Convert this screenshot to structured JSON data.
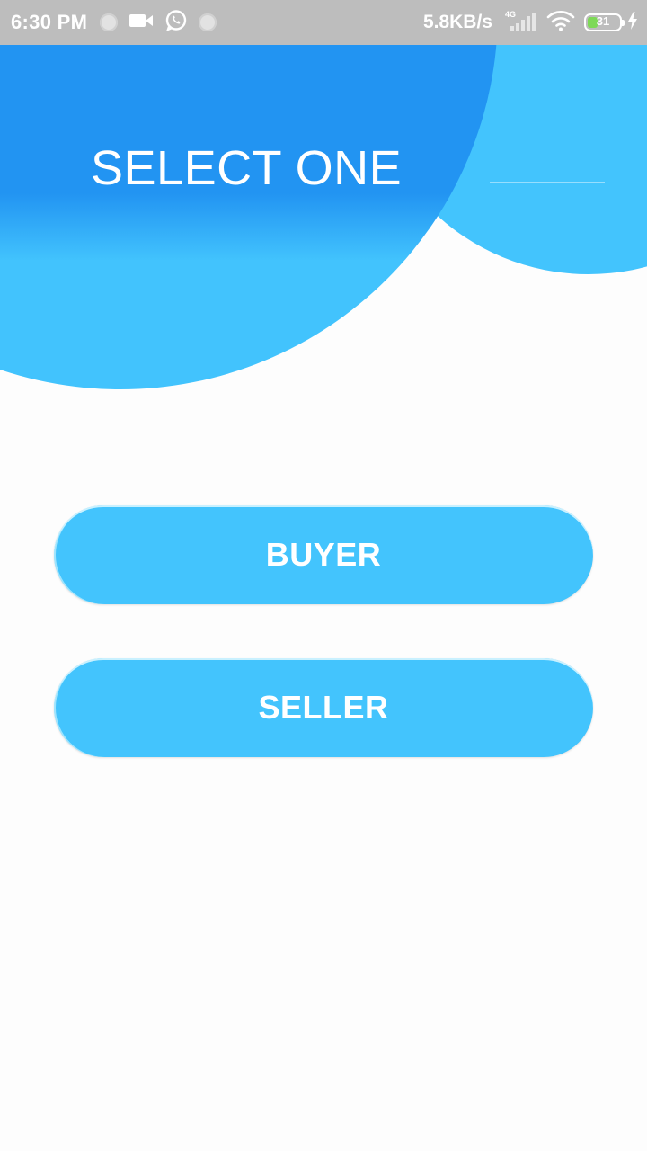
{
  "status_bar": {
    "time": "6:30 PM",
    "net_speed": "5.8KB/s",
    "network_type": "4G",
    "battery_level": "31",
    "battery_fraction": 0.31,
    "icons": [
      "notification-dot-icon",
      "video-camera-icon",
      "whatsapp-icon",
      "notification-dot-icon",
      "signal-icon",
      "wifi-icon",
      "battery-icon",
      "charging-bolt-icon"
    ]
  },
  "header": {
    "title": "SELECT ONE"
  },
  "buttons": {
    "buyer_label": "BUYER",
    "seller_label": "SELLER"
  },
  "colors": {
    "primary_dark": "#2294f2",
    "primary_light": "#43c4fd",
    "status_bar_bg": "#bdbdbd",
    "background": "#fdfdfd",
    "battery_green": "#7ed957"
  }
}
